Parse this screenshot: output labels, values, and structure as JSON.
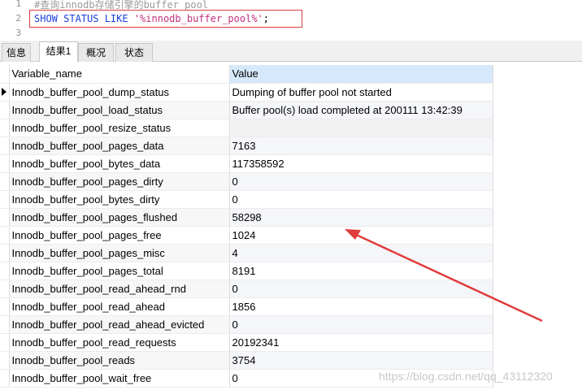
{
  "editor": {
    "line_numbers": [
      "1",
      "2",
      "3"
    ],
    "comment": "#查询innodb存储引擎的buffer pool",
    "sql_keyword": "SHOW STATUS LIKE ",
    "sql_string": "'%innodb_buffer_pool%'",
    "sql_end": ";"
  },
  "tabs": [
    "信息",
    "结果1",
    "概况",
    "状态"
  ],
  "table": {
    "headers": [
      "Variable_name",
      "Value"
    ],
    "rows": [
      [
        "Innodb_buffer_pool_dump_status",
        "Dumping of buffer pool not started"
      ],
      [
        "Innodb_buffer_pool_load_status",
        "Buffer pool(s) load completed at 200111 13:42:39"
      ],
      [
        "Innodb_buffer_pool_resize_status",
        ""
      ],
      [
        "Innodb_buffer_pool_pages_data",
        "7163"
      ],
      [
        "Innodb_buffer_pool_bytes_data",
        "117358592"
      ],
      [
        "Innodb_buffer_pool_pages_dirty",
        "0"
      ],
      [
        "Innodb_buffer_pool_bytes_dirty",
        "0"
      ],
      [
        "Innodb_buffer_pool_pages_flushed",
        "58298"
      ],
      [
        "Innodb_buffer_pool_pages_free",
        "1024"
      ],
      [
        "Innodb_buffer_pool_pages_misc",
        "4"
      ],
      [
        "Innodb_buffer_pool_pages_total",
        "8191"
      ],
      [
        "Innodb_buffer_pool_read_ahead_rnd",
        "0"
      ],
      [
        "Innodb_buffer_pool_read_ahead",
        "1856"
      ],
      [
        "Innodb_buffer_pool_read_ahead_evicted",
        "0"
      ],
      [
        "Innodb_buffer_pool_read_requests",
        "20192341"
      ],
      [
        "Innodb_buffer_pool_reads",
        "3754"
      ],
      [
        "Innodb_buffer_pool_wait_free",
        "0"
      ]
    ]
  },
  "watermark": "https://blog.csdn.net/qq_43112320",
  "colors": {
    "annotation_red": "#e03c3c",
    "header_highlight": "#d6e8fb"
  }
}
